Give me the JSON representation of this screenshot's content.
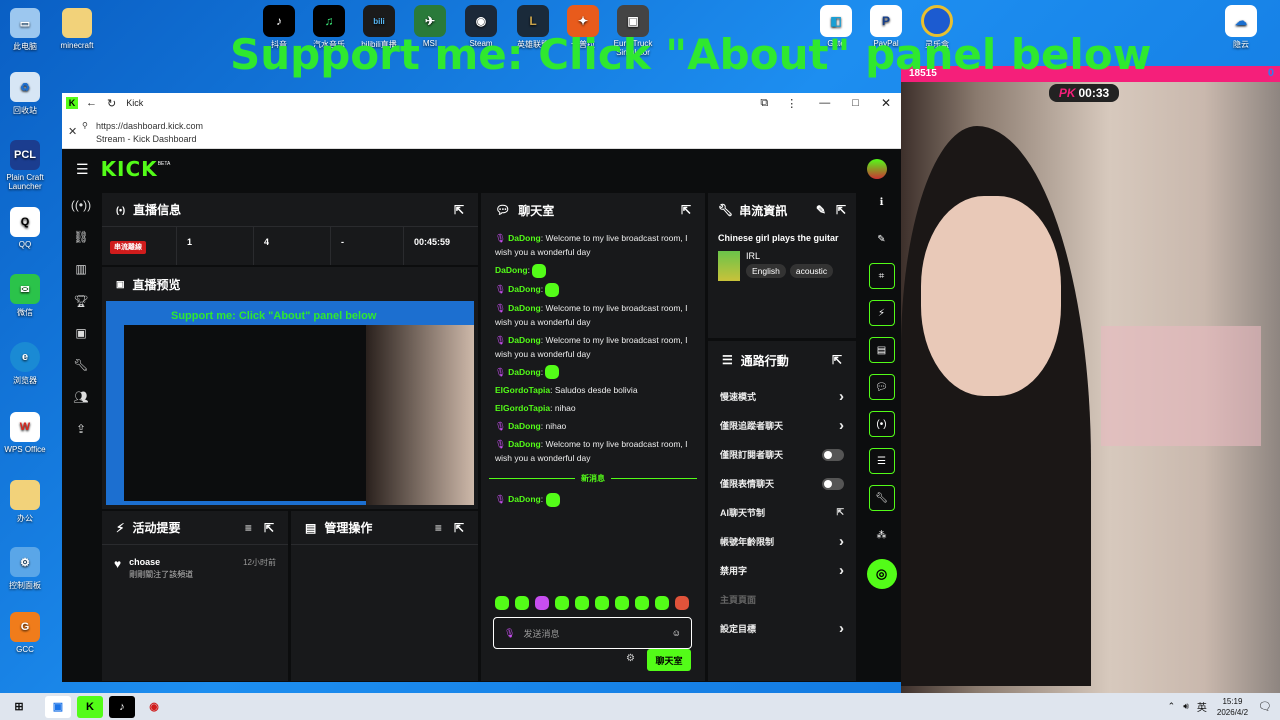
{
  "desktop": {
    "icons_left": [
      "此电脑",
      "回收站",
      "Plain Craft Launcher",
      "QQ",
      "微信",
      "浏览器",
      "WPS Office",
      "办公",
      "控制面板",
      "GCC"
    ],
    "icon_minecraft": "minecraft",
    "icons_top": [
      "抖音",
      "汽水音乐",
      "bilibili直播",
      "MSI",
      "Steam",
      "英雄联盟",
      "卡普拉",
      "Euro Truck Simulator",
      "Gate",
      "PayPal",
      "灵乐盒"
    ],
    "icon_right": "隐云",
    "overlay_text": "Support me: Click \"About\" panel below",
    "pk_score": "18515",
    "pk_score_right": "0",
    "pk_timer": "00:33",
    "pk_label": "PK"
  },
  "browser": {
    "tab_title": "Kick",
    "url": "https://dashboard.kick.com",
    "page_title": "Stream - Kick Dashboard",
    "accent": "#53fc18"
  },
  "kick": {
    "logo": "KICK",
    "logo_beta": "BETA",
    "stream_info": {
      "title": "直播信息",
      "badge": "串流離線",
      "stats": [
        "1",
        "4",
        "-",
        "00:45:59"
      ]
    },
    "preview": {
      "title": "直播预览"
    },
    "chat": {
      "title": "聊天室",
      "messages": [
        {
          "user": "DaDong",
          "text": "Welcome to my live broadcast room, I wish you a wonderful day",
          "mic": true
        },
        {
          "user": "DaDong",
          "text": "",
          "emote": true,
          "mic": false
        },
        {
          "user": "DaDong",
          "text": "",
          "emote": true,
          "mic": true
        },
        {
          "user": "DaDong",
          "text": "Welcome to my live broadcast room, I wish you a wonderful day",
          "mic": true
        },
        {
          "user": "DaDong",
          "text": "Welcome to my live broadcast room, I wish you a wonderful day",
          "mic": true
        },
        {
          "user": "DaDong",
          "text": "",
          "emote": true,
          "mic": true
        },
        {
          "user": "ElGordoTapia",
          "text": "Saludos desde bolivia",
          "mic": false
        },
        {
          "user": "ElGordoTapia",
          "text": "nihao",
          "mic": false
        },
        {
          "user": "DaDong",
          "text": "nihao",
          "mic": true
        },
        {
          "user": "DaDong",
          "text": "Welcome to my live broadcast room, I wish you a wonderful day",
          "mic": true
        }
      ],
      "new_messages": "新消息",
      "last_message": {
        "user": "DaDong",
        "emote": true
      },
      "input_placeholder": "发送消息",
      "send_button": "聊天室"
    },
    "stream_details": {
      "title": "串流資訊",
      "stream_title": "Chinese girl plays the guitar",
      "category": "IRL",
      "tags": [
        "English",
        "acoustic"
      ]
    },
    "quick_actions": {
      "title": "通路行動",
      "items": [
        {
          "label": "慢速模式",
          "control": "arrow"
        },
        {
          "label": "僅限追蹤者聊天",
          "control": "arrow"
        },
        {
          "label": "僅限訂閱者聊天",
          "control": "toggle"
        },
        {
          "label": "僅限表情聊天",
          "control": "toggle"
        },
        {
          "label": "AI聊天节制",
          "control": "external"
        },
        {
          "label": "帳號年齡限制",
          "control": "arrow"
        },
        {
          "label": "禁用字",
          "control": "arrow"
        },
        {
          "label": "主頁頁面",
          "control": "none"
        },
        {
          "label": "設定目標",
          "control": "arrow"
        }
      ]
    },
    "activity": {
      "title": "活动提要",
      "items": [
        {
          "user": "choase",
          "text": "剛剛關注了該頻道",
          "time": "12小时前"
        }
      ]
    },
    "moderation": {
      "title": "管理操作"
    }
  },
  "taskbar": {
    "time": "15:19",
    "date": "2026/4/2",
    "ime": "英"
  }
}
